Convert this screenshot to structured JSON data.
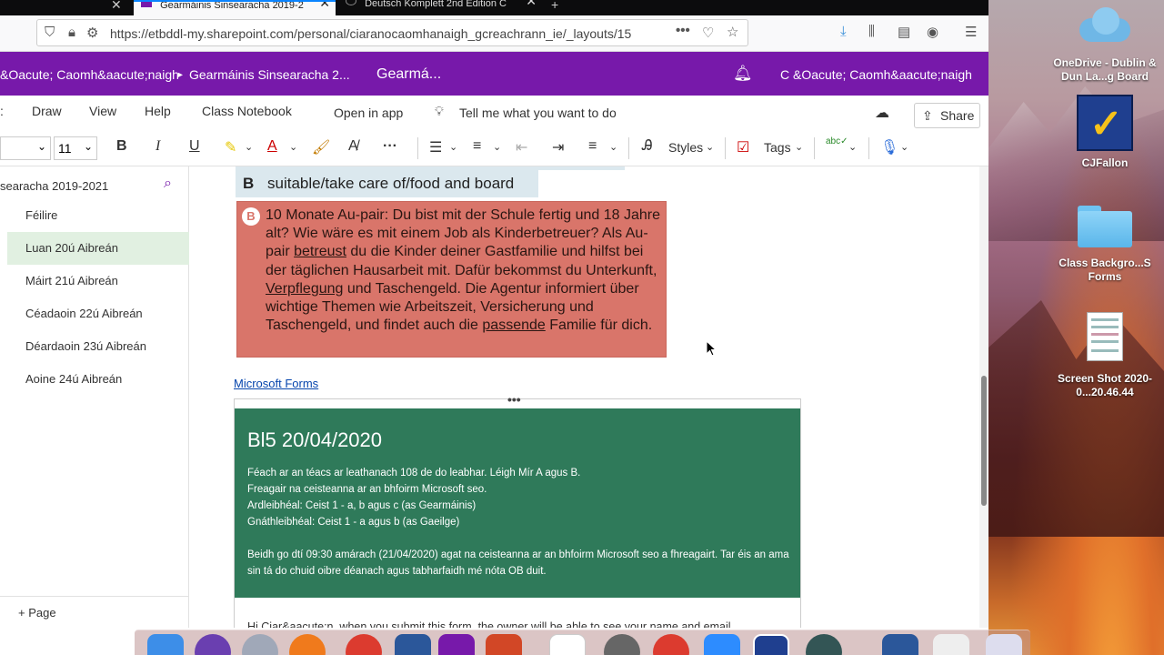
{
  "browser": {
    "tabs": [
      {
        "title": "Gearmáinis Sinsearacha 2019-2"
      },
      {
        "title": "Deutsch Komplett 2nd Edition C"
      }
    ],
    "url": "https://etbddl-my.sharepoint.com/personal/ciaranocaomhanaigh_gcreachrann_ie/_layouts/15"
  },
  "header": {
    "breadcrumb_user": "&Oacute; Caomh&aacute;naigh",
    "breadcrumb_notebook": "Gearmáinis Sinsearacha 2...",
    "section": "Gearmá...",
    "account": "C &Oacute; Caomh&aacute;naigh"
  },
  "ribbon": {
    "tabs": [
      "Draw",
      "View",
      "Help",
      "Class Notebook"
    ],
    "open_in_app": "Open in app",
    "tell_me": "Tell me what you want to do",
    "share": "Share"
  },
  "toolbar": {
    "font_size": "11",
    "bold": "B",
    "italic": "I",
    "underline": "U",
    "styles": "Styles",
    "tags": "Tags"
  },
  "leftpane": {
    "section_title": "searacha 2019-2021",
    "pages": [
      "Féilire",
      "Luan 20ú Aibreán",
      "Máirt 21ú Aibreán",
      "Céadaoin 22ú Aibreán",
      "Déardaoin 23ú Aibreán",
      "Aoine 24ú Aibreán"
    ],
    "add_page": "Page"
  },
  "content": {
    "b_badge": "B",
    "b_line": "suitable/take care of/food and board",
    "red_badge": "B",
    "red_text_1": "10 Monate Au-pair: Du bist mit der Schule fertig und 18 Jahre alt? Wie wäre es mit einem Job als Kinderbetreuer? Als Au-pair ",
    "red_u1": "betreust",
    "red_text_2": " du die Kinder deiner Gastfamilie und hilfst bei der täglichen Hausarbeit mit. Dafür bekommst du Unterkunft, ",
    "red_u2": "Verpflegung",
    "red_text_3": " und Taschengeld. Die Agentur informiert über wichtige Themen wie Arbeitszeit, Versicherung und Taschengeld, und findet auch die ",
    "red_u3": "passende",
    "red_text_4": " Familie für dich.",
    "ms_forms_link": "Microsoft Forms",
    "form_title": "Bl5 20/04/2020",
    "form_lines": [
      "Féach ar an téacs ar leathanach 108 de do leabhar. Léigh Mír A agus B.",
      "Freagair na ceisteanna ar an bhfoirm Microsoft seo.",
      "Ardleibhéal: Ceist 1 - a, b agus c (as Gearmáinis)",
      "Gnáthleibhéal: Ceist 1 - a agus b (as Gaeilge)"
    ],
    "form_deadline": "Beidh go dtí 09:30 amárach (21/04/2020) agat na ceisteanna ar an bhfoirm Microsoft seo a fhreagairt. Tar éis an ama sin tá do chuid oibre déanach agus tabharfaidh mé nóta OB duit.",
    "form_below": "Hi Ciar&aacute;n, when you submit this form, the owner will be able to see your name and email"
  },
  "desktop": {
    "icons": [
      {
        "name": "OneDrive - Dublin & Dun La...g Board"
      },
      {
        "name": "CJFallon"
      },
      {
        "name": "Class Backgro...S Forms"
      },
      {
        "name": "Screen Shot 2020-0...20.46.44"
      }
    ]
  },
  "colors": {
    "onenote_purple": "#7719aa",
    "red_box": "#d9756a",
    "green_box": "#2f7a5a"
  }
}
